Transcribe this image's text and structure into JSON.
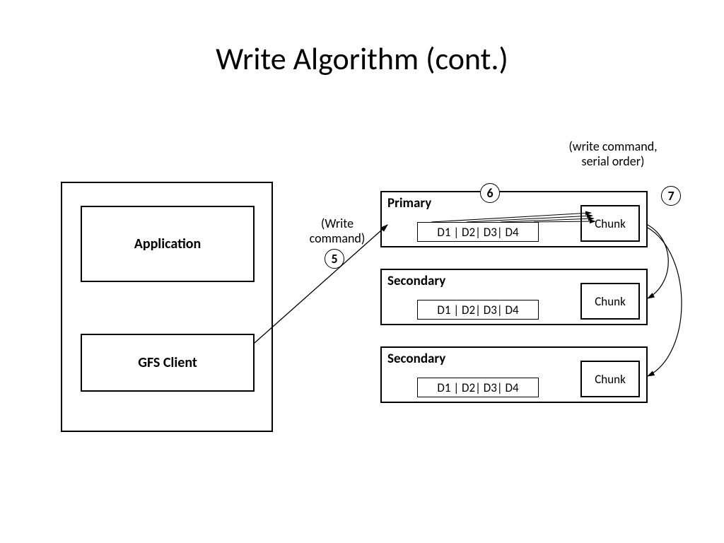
{
  "title": "Write Algorithm (cont.)",
  "left_panel": {
    "app_label": "Application",
    "client_label": "GFS Client"
  },
  "annotations": {
    "write_cmd_line1": "(Write",
    "write_cmd_line2": "command)",
    "top_note_line1": "(write command,",
    "top_note_line2": "serial order)"
  },
  "markers": {
    "m5": "5",
    "m6": "6",
    "m7": "7"
  },
  "servers": {
    "primary": {
      "title": "Primary",
      "data": "D1 | D2| D3| D4",
      "chunk": "Chunk"
    },
    "secondary1": {
      "title": "Secondary",
      "data": "D1 | D2| D3| D4",
      "chunk": "Chunk"
    },
    "secondary2": {
      "title": "Secondary",
      "data": "D1 | D2| D3| D4",
      "chunk": "Chunk"
    }
  }
}
